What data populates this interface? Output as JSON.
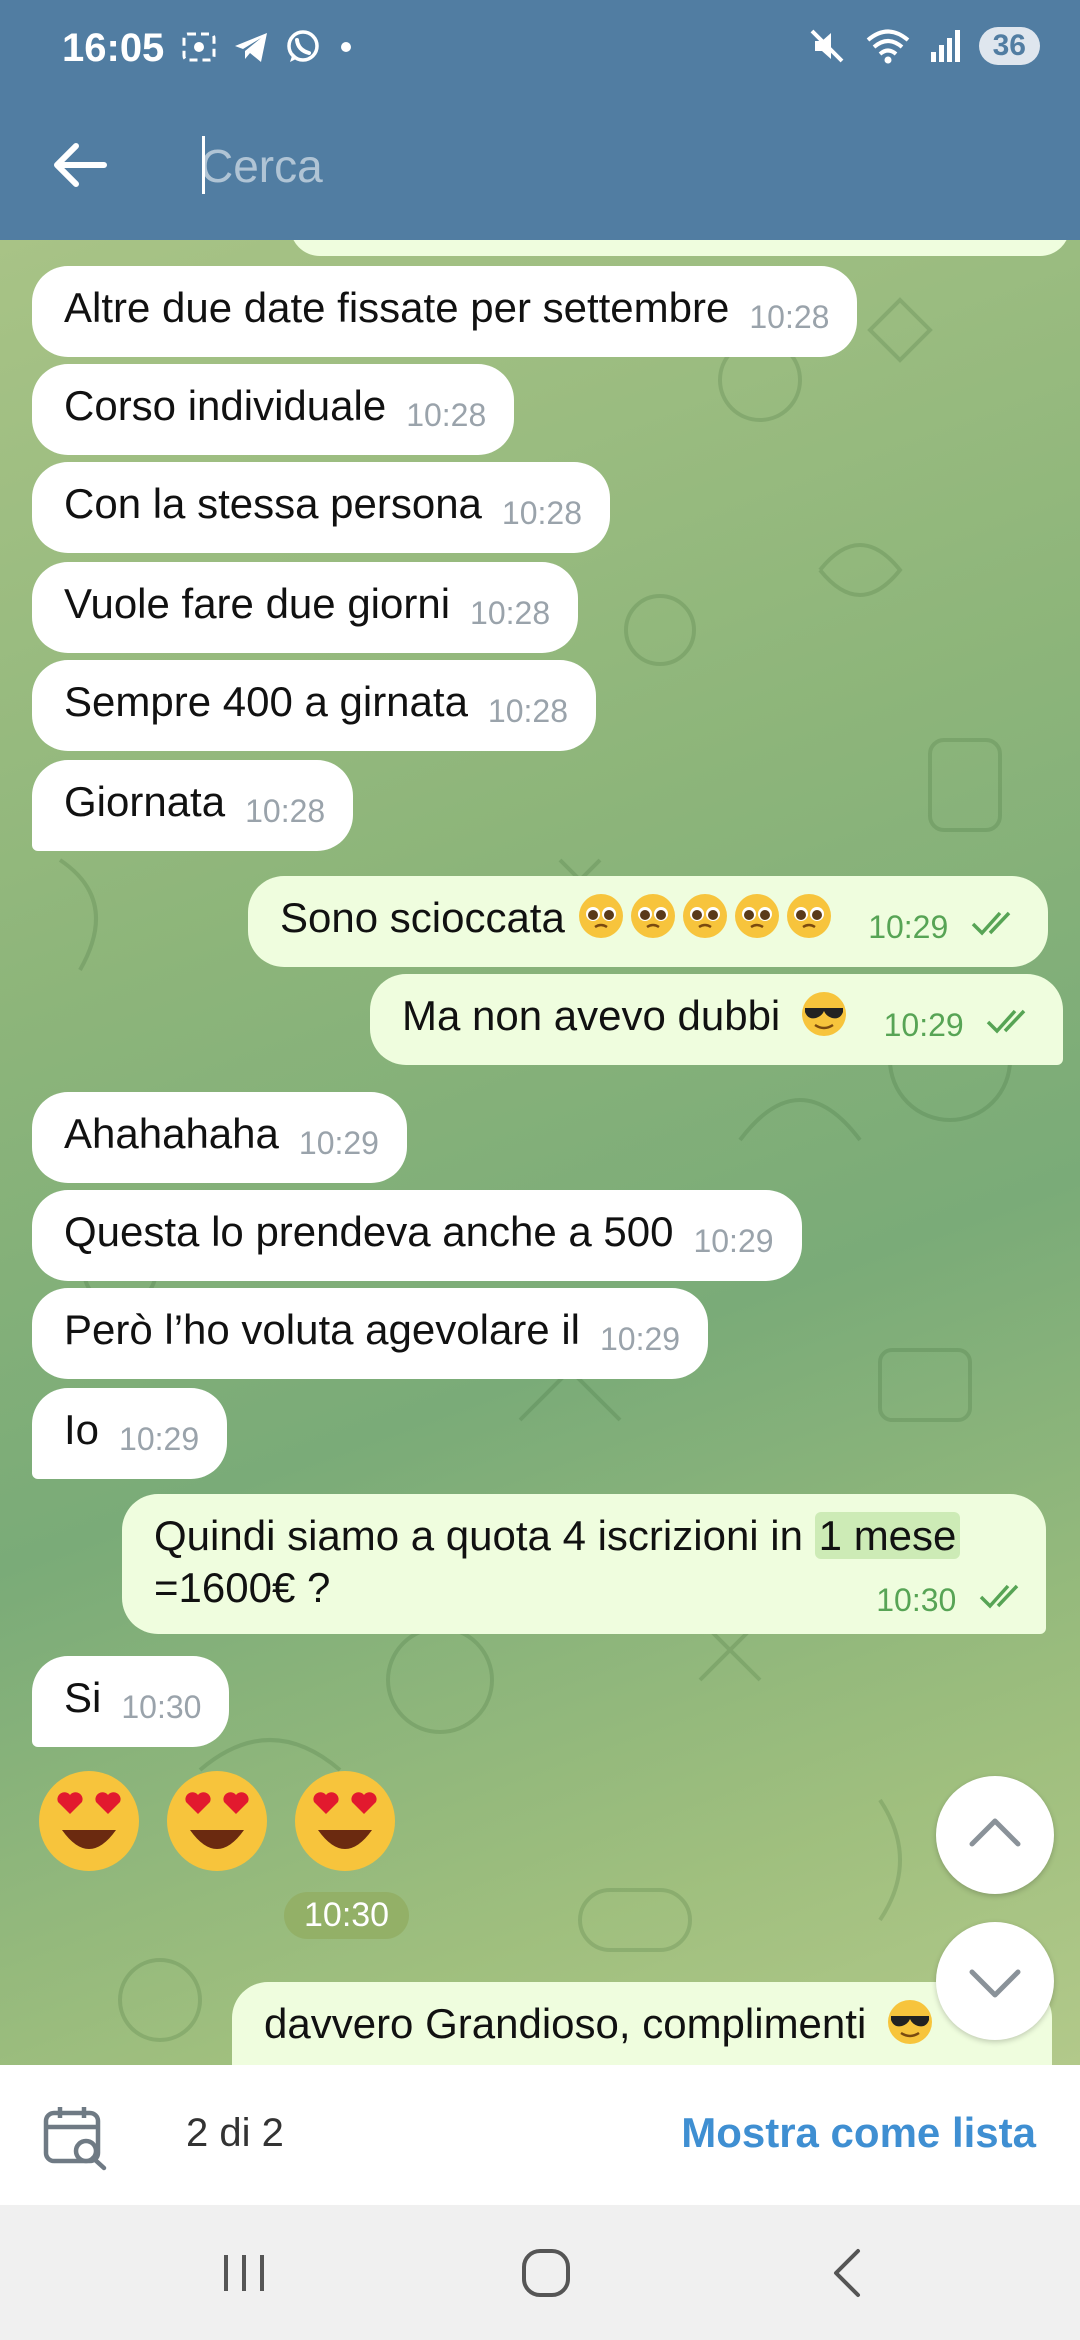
{
  "status_bar": {
    "time": "16:05",
    "battery": "36",
    "icons_left": [
      "screenshot-icon",
      "telegram-icon",
      "whatsapp-icon",
      "dot-icon"
    ],
    "icons_right": [
      "mute-icon",
      "wifi-icon",
      "signal-icon"
    ]
  },
  "search": {
    "placeholder": "Cerca",
    "value": ""
  },
  "messages": [
    {
      "dir": "in",
      "text": "Altre due date fissate per settembre",
      "time": "10:28"
    },
    {
      "dir": "in",
      "text": "Corso individuale",
      "time": "10:28"
    },
    {
      "dir": "in",
      "text": "Con la stessa persona",
      "time": "10:28"
    },
    {
      "dir": "in",
      "text": "Vuole fare due giorni",
      "time": "10:28"
    },
    {
      "dir": "in",
      "text": "Sempre 400 a girnata",
      "time": "10:28"
    },
    {
      "dir": "in",
      "text": "Giornata",
      "time": "10:28"
    },
    {
      "dir": "out",
      "text": "Sono scioccata",
      "time": "10:29",
      "emoji": "pleading-face x5"
    },
    {
      "dir": "out",
      "text": "Ma non avevo dubbi",
      "time": "10:29",
      "emoji": "sunglasses-face"
    },
    {
      "dir": "in",
      "text": "Ahahahaha",
      "time": "10:29"
    },
    {
      "dir": "in",
      "text": "Questa lo prendeva anche a 500",
      "time": "10:29"
    },
    {
      "dir": "in",
      "text": "Però l’ho voluta agevolare il",
      "time": "10:29"
    },
    {
      "dir": "in",
      "text": "Io",
      "time": "10:29"
    },
    {
      "dir": "out",
      "text_before": "Quindi siamo a quota 4 iscrizioni in",
      "text_highlight": "1 mese",
      "text_after": "=1600€ ?",
      "time": "10:30"
    },
    {
      "dir": "in",
      "text": "Si",
      "time": "10:30"
    },
    {
      "dir": "out",
      "text": "davvero Grandioso, complimenti",
      "time": ""
    }
  ],
  "sticker_time": "10:30",
  "bottom_bar": {
    "count": "2 di 2",
    "action": "Mostra come lista"
  },
  "colors": {
    "header": "#517da2",
    "incoming_bubble": "#ffffff",
    "outgoing_bubble": "#effdde",
    "outgoing_time": "#57a455",
    "link": "#3f8fd2"
  }
}
